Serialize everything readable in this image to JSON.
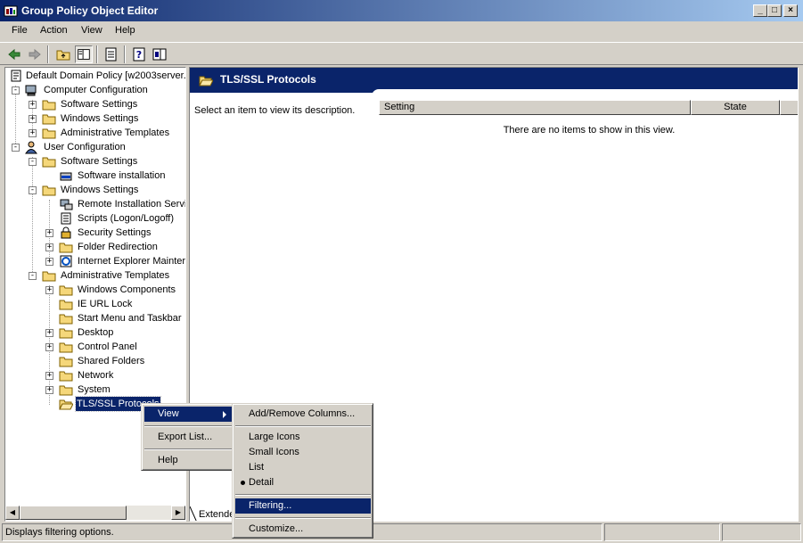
{
  "window": {
    "title": "Group Policy Object Editor",
    "minimize": "_",
    "maximize": "□",
    "close": "×"
  },
  "menubar": {
    "items": [
      {
        "label": "File"
      },
      {
        "label": "Action"
      },
      {
        "label": "View"
      },
      {
        "label": "Help"
      }
    ]
  },
  "tree": {
    "root": "Default Domain Policy [w2003server.",
    "computer_config": "Computer Configuration",
    "cc_software": "Software Settings",
    "cc_windows": "Windows Settings",
    "cc_admin": "Administrative Templates",
    "user_config": "User Configuration",
    "uc_software": "Software Settings",
    "uc_software_install": "Software installation",
    "uc_windows": "Windows Settings",
    "uc_remote_install": "Remote Installation Servi",
    "uc_scripts": "Scripts (Logon/Logoff)",
    "uc_security": "Security Settings",
    "uc_folder_redirect": "Folder Redirection",
    "uc_ie_maint": "Internet Explorer Mainter",
    "uc_admin": "Administrative Templates",
    "uc_win_components": "Windows Components",
    "uc_ie_url_lock": "IE URL Lock",
    "uc_start_menu": "Start Menu and Taskbar",
    "uc_desktop": "Desktop",
    "uc_control_panel": "Control Panel",
    "uc_shared_folders": "Shared Folders",
    "uc_network": "Network",
    "uc_system": "System",
    "uc_tls": "TLS/SSL Protocols"
  },
  "right_pane": {
    "title": "TLS/SSL Protocols",
    "description": "Select an item to view its description.",
    "col_setting": "Setting",
    "col_state": "State",
    "empty_message": "There are no items to show in this view.",
    "tab_extended": "Extende"
  },
  "status": {
    "text": "Displays filtering options."
  },
  "context_menu": {
    "view": "View",
    "export_list": "Export List...",
    "help": "Help"
  },
  "submenu": {
    "add_remove_columns": "Add/Remove Columns...",
    "large_icons": "Large Icons",
    "small_icons": "Small Icons",
    "list": "List",
    "detail": "Detail",
    "filtering": "Filtering...",
    "customize": "Customize..."
  },
  "colors": {
    "titlebar_start": "#0a246a",
    "titlebar_end": "#a6caf0",
    "highlight": "#0a246a",
    "face": "#d4d0c8",
    "folder": "#f5d77a"
  }
}
